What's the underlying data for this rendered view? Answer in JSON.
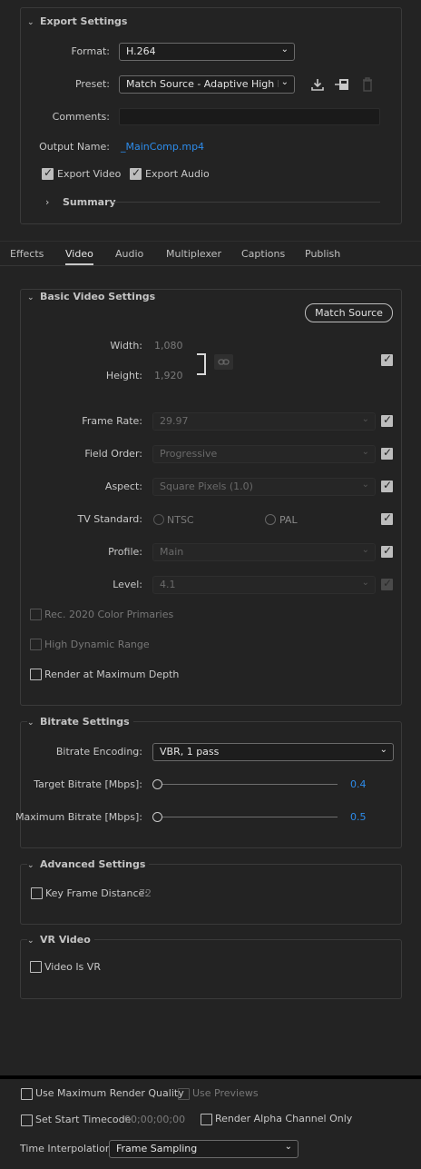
{
  "export_settings": {
    "title": "Export Settings",
    "format_label": "Format:",
    "format_value": "H.264",
    "preset_label": "Preset:",
    "preset_value": "Match Source - Adaptive High Bit...",
    "comments_label": "Comments:",
    "comments_value": "",
    "output_name_label": "Output Name:",
    "output_name_value": "_MainComp.mp4",
    "export_video_label": "Export Video",
    "export_video_checked": true,
    "export_audio_label": "Export Audio",
    "export_audio_checked": true,
    "summary_label": "Summary"
  },
  "tabs": [
    {
      "label": "Effects",
      "active": false
    },
    {
      "label": "Video",
      "active": true
    },
    {
      "label": "Audio",
      "active": false
    },
    {
      "label": "Multiplexer",
      "active": false
    },
    {
      "label": "Captions",
      "active": false
    },
    {
      "label": "Publish",
      "active": false
    }
  ],
  "basic_video": {
    "title": "Basic Video Settings",
    "match_source_label": "Match Source",
    "width_label": "Width:",
    "width_value": "1,080",
    "height_label": "Height:",
    "height_value": "1,920",
    "frame_rate_label": "Frame Rate:",
    "frame_rate_value": "29.97",
    "field_order_label": "Field Order:",
    "field_order_value": "Progressive",
    "aspect_label": "Aspect:",
    "aspect_value": "Square Pixels (1.0)",
    "tv_standard_label": "TV Standard:",
    "tv_ntsc_label": "NTSC",
    "tv_pal_label": "PAL",
    "profile_label": "Profile:",
    "profile_value": "Main",
    "level_label": "Level:",
    "level_value": "4.1",
    "rec2020_label": "Rec. 2020 Color Primaries",
    "hdr_label": "High Dynamic Range",
    "max_depth_label": "Render at Maximum Depth"
  },
  "bitrate": {
    "title": "Bitrate Settings",
    "encoding_label": "Bitrate Encoding:",
    "encoding_value": "VBR, 1 pass",
    "target_label": "Target Bitrate [Mbps]:",
    "target_value": "0.4",
    "max_label": "Maximum Bitrate [Mbps]:",
    "max_value": "0.5"
  },
  "advanced": {
    "title": "Advanced Settings",
    "key_frame_label": "Key Frame Distance:",
    "key_frame_value": "72"
  },
  "vr": {
    "title": "VR Video",
    "is_vr_label": "Video Is VR"
  },
  "footer": {
    "max_render_quality_label": "Use Maximum Render Quality",
    "use_previews_label": "Use Previews",
    "start_timecode_label": "Set Start Timecode",
    "start_timecode_value": "00;00;00;00",
    "alpha_only_label": "Render Alpha Channel Only",
    "time_interp_label": "Time Interpolation:",
    "time_interp_value": "Frame Sampling"
  },
  "colors": {
    "background": "#232323",
    "accent_link": "#2d8ceb",
    "footer_divider": "#000000"
  }
}
